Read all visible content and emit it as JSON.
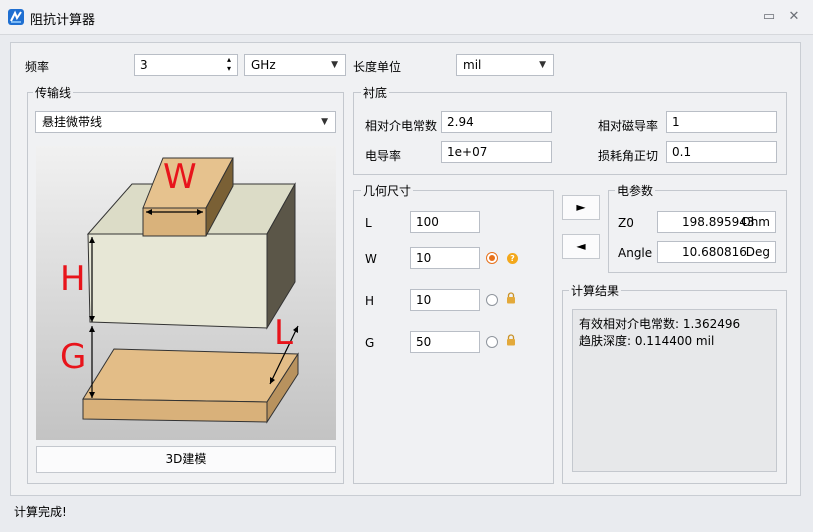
{
  "window": {
    "title": "阻抗计算器",
    "help_glyph": "▭",
    "close_glyph": "✕"
  },
  "frequency": {
    "label": "频率",
    "value": "3",
    "unit": "GHz",
    "length_unit_label": "长度单位",
    "length_unit": "mil"
  },
  "transmission_line": {
    "legend": "传输线",
    "type": "悬挂微带线",
    "model_button": "3D建模",
    "diagram_labels": {
      "w": "W",
      "h": "H",
      "g": "G",
      "l": "L"
    }
  },
  "substrate": {
    "legend": "衬底",
    "er_label": "相对介电常数",
    "er_value": "2.94",
    "mur_label": "相对磁导率",
    "mur_value": "1",
    "sigma_label": "电导率",
    "sigma_value": "1e+07",
    "tand_label": "损耗角正切",
    "tand_value": "0.1"
  },
  "geometry": {
    "legend": "几何尺寸",
    "rows": [
      {
        "label": "L",
        "value": "100"
      },
      {
        "label": "W",
        "value": "10"
      },
      {
        "label": "H",
        "value": "10"
      },
      {
        "label": "G",
        "value": "50"
      }
    ],
    "selected_row": "W"
  },
  "actions": {
    "synthesize_glyph": "►",
    "analyze_glyph": "◄"
  },
  "electrical": {
    "legend": "电参数",
    "z0_label": "Z0",
    "z0_value": "198.895943",
    "z0_unit": "Ohm",
    "angle_label": "Angle",
    "angle_value": "10.680816",
    "angle_unit": "Deg"
  },
  "results": {
    "legend": "计算结果",
    "line1": "有效相对介电常数: 1.362496",
    "line2": "趋肤深度: 0.114400 mil"
  },
  "status": {
    "text": "计算完成!"
  },
  "colors": {
    "accent": "#e7711b",
    "copper": "#ddb57d",
    "label_red": "#e8141b"
  }
}
